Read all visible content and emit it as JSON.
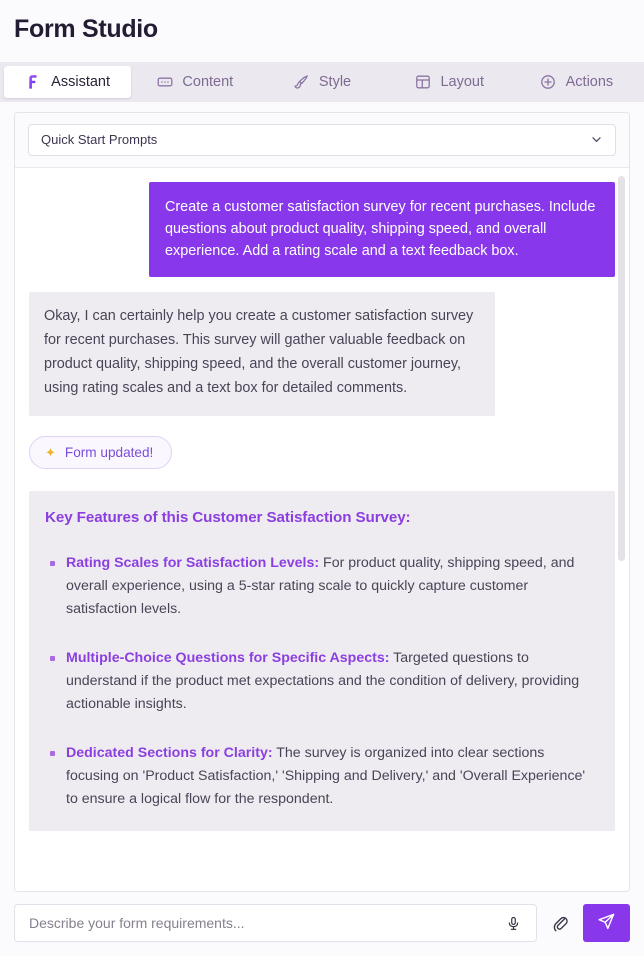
{
  "header": {
    "title": "Form Studio"
  },
  "tabs": [
    {
      "label": "Assistant",
      "icon": "assistant-logo-icon",
      "active": true
    },
    {
      "label": "Content",
      "icon": "text-field-icon",
      "active": false
    },
    {
      "label": "Style",
      "icon": "paintbrush-icon",
      "active": false
    },
    {
      "label": "Layout",
      "icon": "layout-panel-icon",
      "active": false
    },
    {
      "label": "Actions",
      "icon": "plus-circle-icon",
      "active": false
    }
  ],
  "quickstart": {
    "label": "Quick Start Prompts",
    "icon": "chevron-down-icon"
  },
  "conversation": {
    "user_message": "Create a customer satisfaction survey for recent purchases. Include questions about product quality, shipping speed, and overall experience. Add a rating scale and a text feedback box.",
    "assistant_message": "Okay, I can certainly help you create a customer satisfaction survey for recent purchases. This survey will gather valuable feedback on product quality, shipping speed, and the overall customer journey, using rating scales and a text box for detailed comments.",
    "status_badge": {
      "icon": "sparkle-icon",
      "glyph": "✦",
      "label": "Form updated!"
    },
    "features": {
      "title": "Key Features of this Customer Satisfaction Survey:",
      "items": [
        {
          "label": "Rating Scales for Satisfaction Levels:",
          "text": " For product quality, shipping speed, and overall experience, using a 5-star rating scale to quickly capture customer satisfaction levels."
        },
        {
          "label": "Multiple-Choice Questions for Specific Aspects:",
          "text": " Targeted questions to understand if the product met expectations and the condition of delivery, providing actionable insights."
        },
        {
          "label": "Dedicated Sections for Clarity:",
          "text": " The survey is organized into clear sections focusing on 'Product Satisfaction,' 'Shipping and Delivery,' and 'Overall Experience' to ensure a logical flow for the respondent."
        }
      ]
    }
  },
  "composer": {
    "placeholder": "Describe your form requirements...",
    "value": "",
    "mic_icon": "microphone-icon",
    "attach_icon": "paperclip-icon",
    "send_icon": "send-paper-plane-icon"
  },
  "colors": {
    "accent": "#8838ea",
    "accent_text": "#8b3fe0",
    "bubble_bot_bg": "#efecf1",
    "tabstrip_bg": "#ece8f0",
    "sparkle": "#f0b429"
  }
}
